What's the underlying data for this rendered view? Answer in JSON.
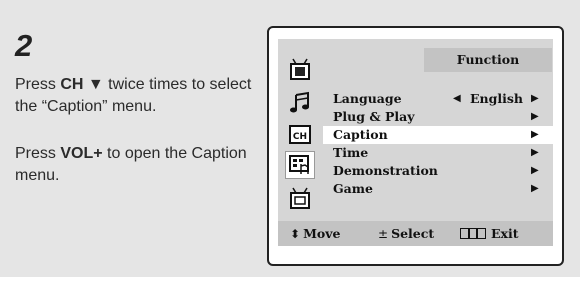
{
  "step": {
    "number": "2",
    "instruction1": {
      "prefix": "Press ",
      "key": "CH ▼",
      "suffix": " twice times to select the “Caption” menu."
    },
    "instruction2": {
      "prefix": "Press ",
      "key": "VOL+",
      "suffix": " to open the Caption menu."
    }
  },
  "osd": {
    "title": "Function",
    "icons": [
      "tv-picture-icon",
      "sound-note-icon",
      "channel-icon",
      "function-hand-icon",
      "setup-tv-icon"
    ],
    "selected_icon": "function-hand-icon",
    "menu": [
      {
        "label": "Language",
        "value": "English",
        "left_arrow": "◀",
        "right_arrow": "▶"
      },
      {
        "label": "Plug & Play",
        "value": "",
        "left_arrow": "",
        "right_arrow": "▶"
      },
      {
        "label": "Caption",
        "value": "",
        "left_arrow": "",
        "right_arrow": "▶",
        "selected": true
      },
      {
        "label": "Time",
        "value": "",
        "left_arrow": "",
        "right_arrow": "▶"
      },
      {
        "label": "Demonstration",
        "value": "",
        "left_arrow": "",
        "right_arrow": "▶"
      },
      {
        "label": "Game",
        "value": "",
        "left_arrow": "",
        "right_arrow": "▶"
      }
    ],
    "footer": {
      "move_symbol": "⬍",
      "move_label": "Move",
      "select_symbol": "±",
      "select_label": "Select",
      "exit_label": "Exit"
    }
  },
  "colors": {
    "panel_bg": "#e5e5e5",
    "osd_bg": "#d6d6d6",
    "osd_bar": "#c3c3c3",
    "highlight": "#ffffff"
  }
}
